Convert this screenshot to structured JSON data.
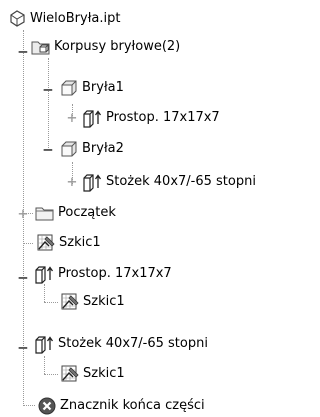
{
  "tree": {
    "root": {
      "label": "WieloBryła.ipt",
      "icon": "part-file-icon"
    },
    "korpusy": {
      "label": "Korpusy bryłowe(2)",
      "icon": "solid-bodies-folder-icon",
      "expanded": true
    },
    "bryla1": {
      "label": "Bryła1",
      "icon": "solid-body-icon",
      "expanded": true
    },
    "prostop_sub": {
      "label": "Prostop. 17x17x7",
      "icon": "extrude-icon",
      "expanded": false
    },
    "bryla2": {
      "label": "Bryła2",
      "icon": "solid-body-icon",
      "expanded": true
    },
    "stozek_sub": {
      "label": "Stożek 40x7/-65 stopni",
      "icon": "extrude-icon",
      "expanded": false
    },
    "poczatek": {
      "label": "Początek",
      "icon": "origin-folder-icon",
      "expanded": false
    },
    "szkic_a": {
      "label": "Szkic1",
      "icon": "sketch-icon"
    },
    "prostop": {
      "label": "Prostop. 17x17x7",
      "icon": "extrude-icon",
      "expanded": true
    },
    "szkic_b": {
      "label": "Szkic1",
      "icon": "sketch-icon"
    },
    "stozek": {
      "label": "Stożek 40x7/-65 stopni",
      "icon": "extrude-icon",
      "expanded": true
    },
    "szkic_c": {
      "label": "Szkic1",
      "icon": "sketch-icon"
    },
    "koniec": {
      "label": "Znacznik końca części",
      "icon": "end-of-part-icon"
    }
  },
  "colors": {
    "tree_line": "#9a9a9a",
    "end_marker": "#555555"
  }
}
